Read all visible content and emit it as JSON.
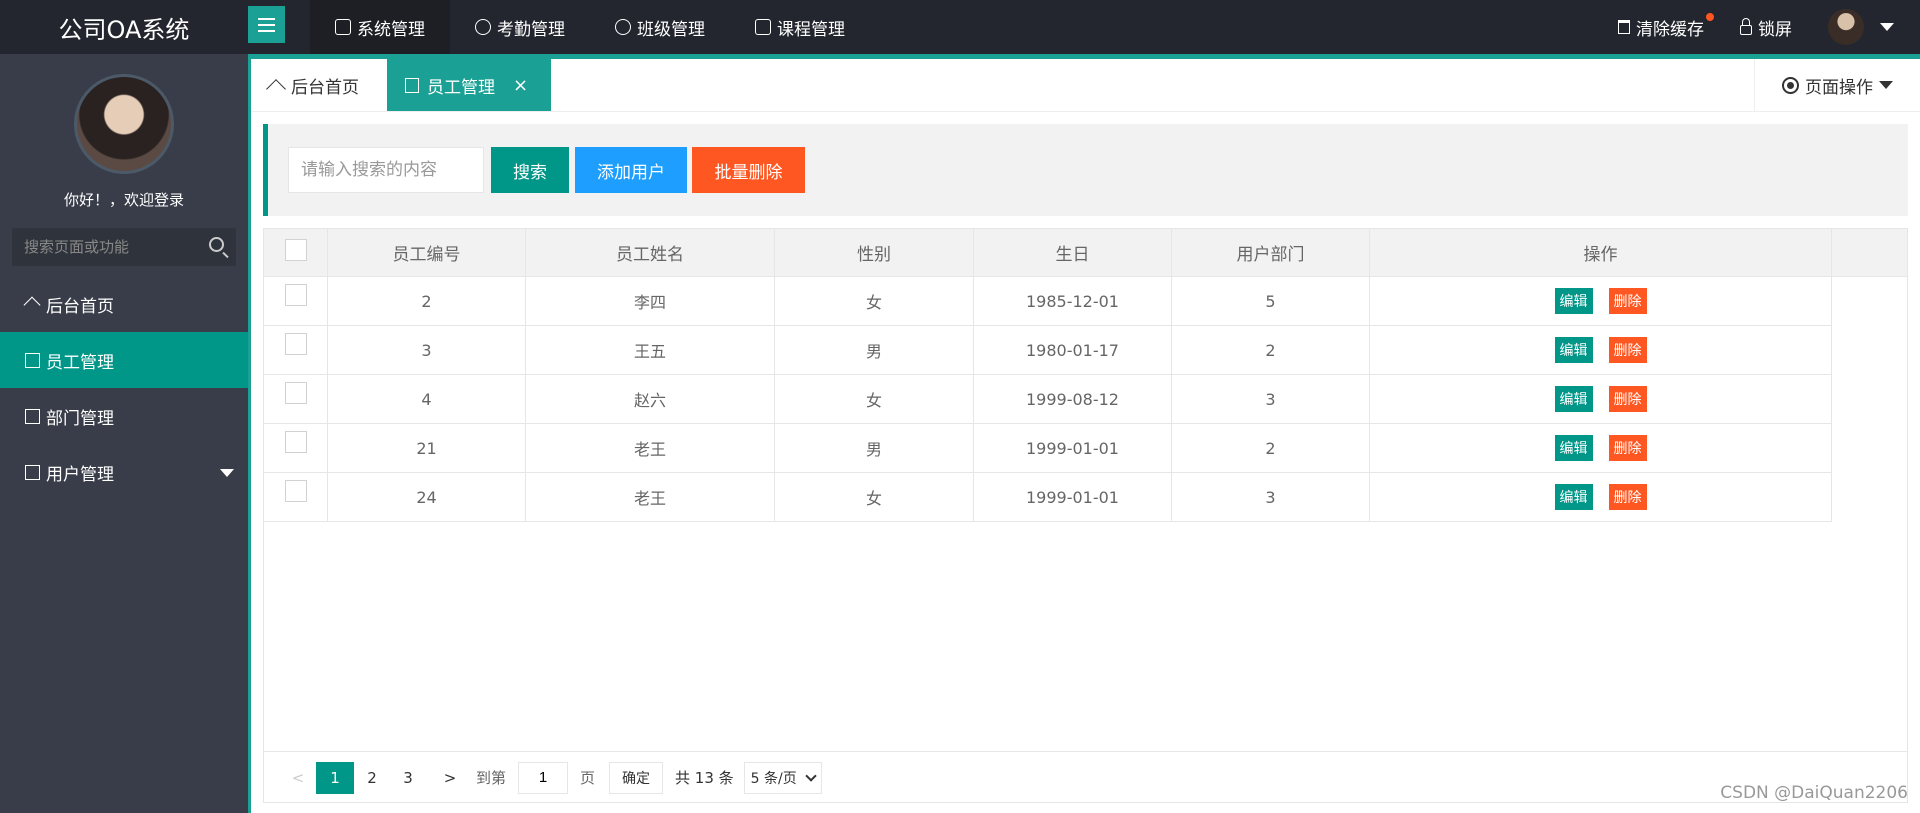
{
  "header": {
    "logo": "公司OA系统",
    "nav": [
      {
        "label": "系统管理",
        "icon": "document-icon"
      },
      {
        "label": "考勤管理",
        "icon": "users-icon"
      },
      {
        "label": "班级管理",
        "icon": "gear-icon"
      },
      {
        "label": "课程管理",
        "icon": "car-icon"
      }
    ],
    "clear_cache": "清除缓存",
    "lock_screen": "锁屏"
  },
  "sidebar": {
    "welcome": "你好！，欢迎登录",
    "search_placeholder": "搜索页面或功能",
    "items": [
      {
        "label": "后台首页",
        "icon": "home-icon"
      },
      {
        "label": "员工管理",
        "icon": "document-icon"
      },
      {
        "label": "部门管理",
        "icon": "image-icon"
      },
      {
        "label": "用户管理",
        "icon": "chart-icon"
      }
    ]
  },
  "tabs": {
    "home": "后台首页",
    "active": "员工管理",
    "close": "×",
    "page_ops": "页面操作"
  },
  "toolbar": {
    "search_placeholder": "请输入搜索的内容",
    "search": "搜索",
    "add_user": "添加用户",
    "batch_delete": "批量删除"
  },
  "table": {
    "columns": [
      "员工编号",
      "员工姓名",
      "性别",
      "生日",
      "用户部门",
      "操作"
    ],
    "rows": [
      {
        "id": "2",
        "name": "李四",
        "gender": "女",
        "birthday": "1985-12-01",
        "dept": "5"
      },
      {
        "id": "3",
        "name": "王五",
        "gender": "男",
        "birthday": "1980-01-17",
        "dept": "2"
      },
      {
        "id": "4",
        "name": "赵六",
        "gender": "女",
        "birthday": "1999-08-12",
        "dept": "3"
      },
      {
        "id": "21",
        "name": "老王",
        "gender": "男",
        "birthday": "1999-01-01",
        "dept": "2"
      },
      {
        "id": "24",
        "name": "老王",
        "gender": "女",
        "birthday": "1999-01-01",
        "dept": "3"
      }
    ],
    "edit_label": "编辑",
    "delete_label": "删除"
  },
  "pager": {
    "prev": "<",
    "pages": [
      "1",
      "2",
      "3"
    ],
    "next": ">",
    "goto": "到第",
    "page_value": "1",
    "page_unit": "页",
    "confirm": "确定",
    "total": "共 13 条",
    "page_size": "5 条/页"
  },
  "watermark": "CSDN @DaiQuan2206"
}
